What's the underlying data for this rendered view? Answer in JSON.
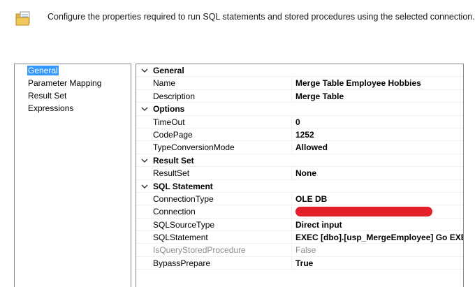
{
  "header": {
    "description": "Configure the properties required to run SQL statements and stored procedures using the selected connection.",
    "icon": "document-folder-icon"
  },
  "nav": {
    "items": [
      {
        "label": "General",
        "selected": true
      },
      {
        "label": "Parameter Mapping",
        "selected": false
      },
      {
        "label": "Result Set",
        "selected": false
      },
      {
        "label": "Expressions",
        "selected": false
      }
    ]
  },
  "grid": {
    "categories": [
      {
        "label": "General",
        "properties": [
          {
            "name": "Name",
            "value": "Merge Table Employee Hobbies"
          },
          {
            "name": "Description",
            "value": "Merge Table"
          }
        ]
      },
      {
        "label": "Options",
        "properties": [
          {
            "name": "TimeOut",
            "value": "0"
          },
          {
            "name": "CodePage",
            "value": "1252"
          },
          {
            "name": "TypeConversionMode",
            "value": "Allowed"
          }
        ]
      },
      {
        "label": "Result Set",
        "properties": [
          {
            "name": "ResultSet",
            "value": "None"
          }
        ]
      },
      {
        "label": "SQL Statement",
        "properties": [
          {
            "name": "ConnectionType",
            "value": "OLE DB"
          },
          {
            "name": "Connection",
            "value": "",
            "redacted": true
          },
          {
            "name": "SQLSourceType",
            "value": "Direct input"
          },
          {
            "name": "SQLStatement",
            "value": "EXEC [dbo].[usp_MergeEmployee] Go EXEC"
          },
          {
            "name": "IsQueryStoredProcedure",
            "value": "False",
            "disabled": true
          },
          {
            "name": "BypassPrepare",
            "value": "True"
          }
        ]
      }
    ]
  },
  "colors": {
    "selection": "#3399ff",
    "redaction": "#e3202a",
    "border": "#828790",
    "disabled_text": "#8c8c8c"
  }
}
